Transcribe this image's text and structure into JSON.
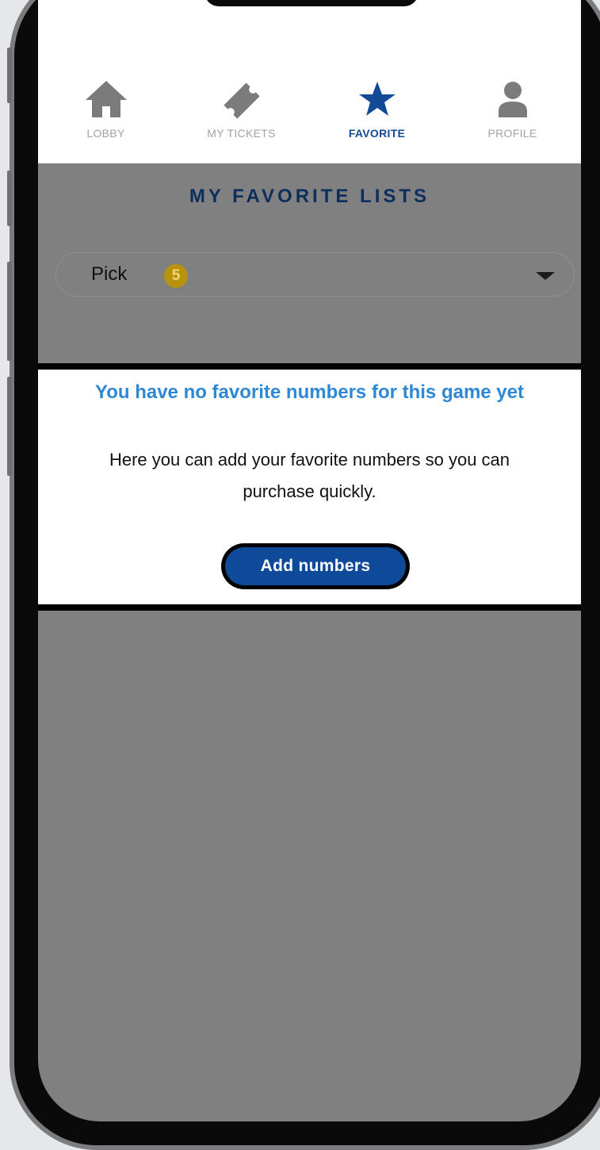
{
  "tabbar": {
    "tabs": [
      {
        "label": "LOBBY",
        "icon": "home-icon",
        "active": false
      },
      {
        "label": "MY TICKETS",
        "icon": "ticket-icon",
        "active": false
      },
      {
        "label": "FAVORITE",
        "icon": "star-icon",
        "active": true
      },
      {
        "label": "PROFILE",
        "icon": "user-icon",
        "active": false
      }
    ]
  },
  "page": {
    "title": "MY FAVORITE LISTS"
  },
  "game_select": {
    "value": "Pick",
    "badge": "5",
    "icon": "chevron-down-icon"
  },
  "empty_state": {
    "title": "You have no favorite numbers for this game yet",
    "description": "Here you can add your favorite numbers so you can purchase quickly.",
    "button_label": "Add numbers"
  },
  "colors": {
    "active_tab": "#134a96",
    "inactive_tab": "#a2a2a2",
    "accent_title": "#2f88d6",
    "button_bg": "#0f4a98",
    "badge_bg": "#b9930d",
    "overlay": "#808080"
  }
}
